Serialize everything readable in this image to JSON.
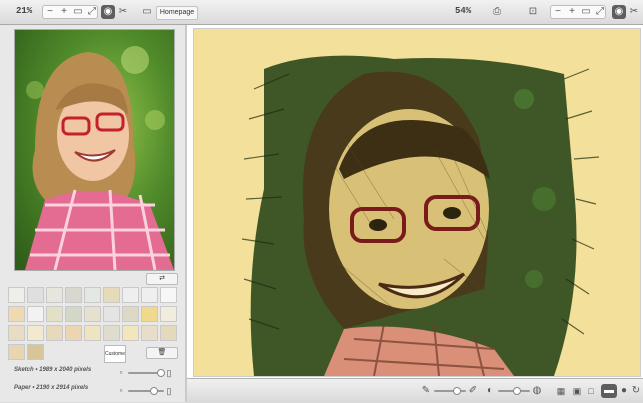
{
  "toolbar": {
    "left_zoom": "21%",
    "homepage_label": "Homepage",
    "right_zoom": "54%",
    "icons_left": [
      "minus-icon",
      "plus-icon",
      "fit-icon",
      "fullscreen-icon",
      "eye-icon",
      "crop-icon",
      "folder-icon"
    ],
    "icons_right": [
      "print-icon",
      "export-icon",
      "minus-icon",
      "plus-icon",
      "fit-icon",
      "fullscreen-icon",
      "eye-icon",
      "crop-icon"
    ]
  },
  "left_panel": {
    "custom_label": "Custome",
    "sketch_info": "Sketch • 1989 x 2040 pixels",
    "paper_info": "Paper • 2190 x 2914 pixels"
  },
  "paper_textures": {
    "colors": [
      "#eeeeea",
      "#dfdfdf",
      "#e7e5dc",
      "#d8d8d0",
      "#e4e8e5",
      "#e6dbb8",
      "#eeeeee",
      "#efefef",
      "#f7f7f7",
      "#efd9b1",
      "#f2f2f2",
      "#e3e0c8",
      "#d2d7c8",
      "#e6e0cf",
      "#e4e4e4",
      "#ded8c7",
      "#f0d98c",
      "#f0edde",
      "#eadcc2",
      "#f1ead1",
      "#e9d9bc",
      "#ecd5b1",
      "#f0e3c0",
      "#dddccd",
      "#f3e6bd",
      "#e7ddc8",
      "#e5d9bd",
      "#e8d6b1",
      "#d8c59a"
    ]
  },
  "canvas": {
    "paper_color": "#f3e09a",
    "accent_color": "#5e5e5e"
  }
}
